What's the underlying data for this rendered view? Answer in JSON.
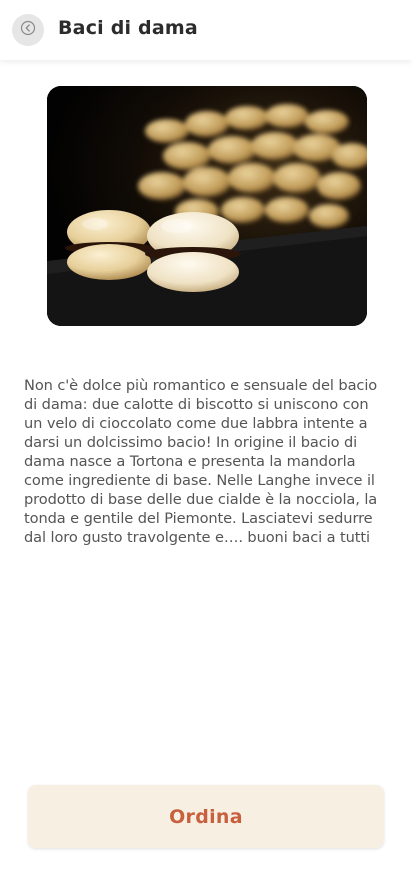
{
  "header": {
    "title": "Baci di dama",
    "back_icon": "back-arrow-circle-icon"
  },
  "recipe": {
    "image_alt": "photo of baci di dama cookies",
    "description": "Non c'è dolce più romantico e sensuale del bacio di dama:  due calotte di biscotto si uniscono con un velo di cioccolato come due labbra intente a darsi un dolcissimo bacio! In origine il bacio di dama nasce a Tortona e presenta la mandorla come ingrediente di base. Nelle Langhe invece il prodotto di base delle due cialde è la nocciola, la tonda e gentile del Piemonte. Lasciatevi sedurre dal loro gusto travolgente e…. buoni baci a tutti"
  },
  "actions": {
    "order_label": "Ordina"
  },
  "colors": {
    "accent": "#c8603e",
    "button_bg": "#f7f0e2",
    "text": "#555555"
  }
}
